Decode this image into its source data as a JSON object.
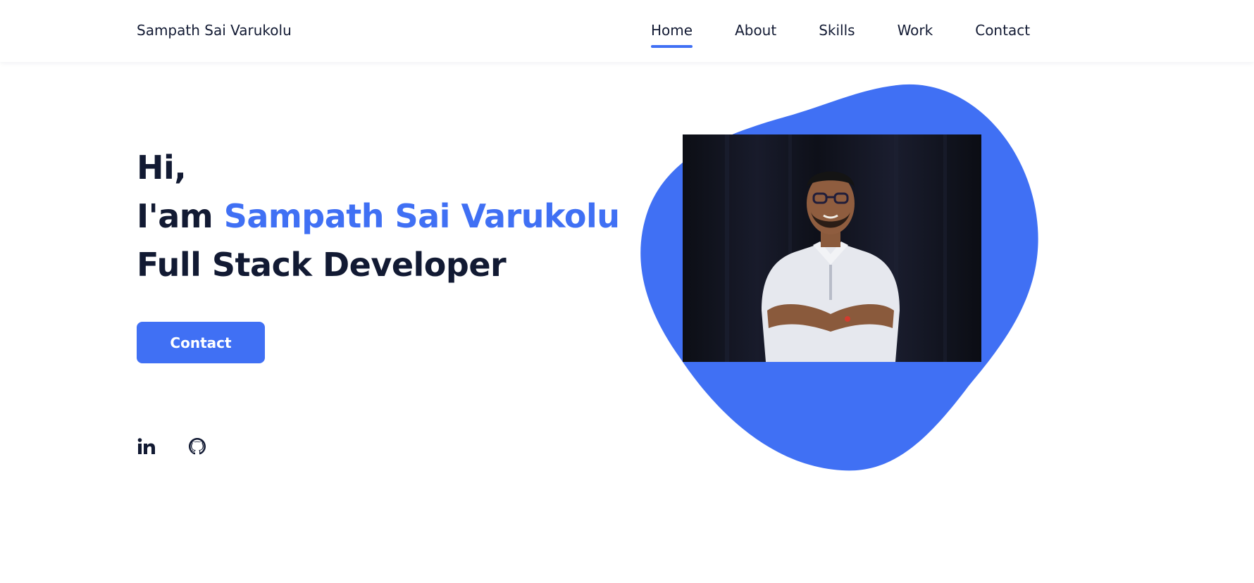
{
  "site": {
    "logo": "Sampath Sai Varukolu"
  },
  "nav": {
    "items": [
      {
        "label": "Home",
        "active": true
      },
      {
        "label": "About",
        "active": false
      },
      {
        "label": "Skills",
        "active": false
      },
      {
        "label": "Work",
        "active": false
      },
      {
        "label": "Contact",
        "active": false
      }
    ]
  },
  "hero": {
    "greeting": "Hi,",
    "intro_prefix": "I'am ",
    "name": "Sampath Sai Varukolu",
    "role": "Full Stack Developer",
    "contact_button": "Contact"
  },
  "social": {
    "icons": [
      "linkedin-icon",
      "github-icon"
    ]
  },
  "colors": {
    "accent": "#4070f4",
    "text": "#121a33",
    "background": "#ffffff"
  }
}
